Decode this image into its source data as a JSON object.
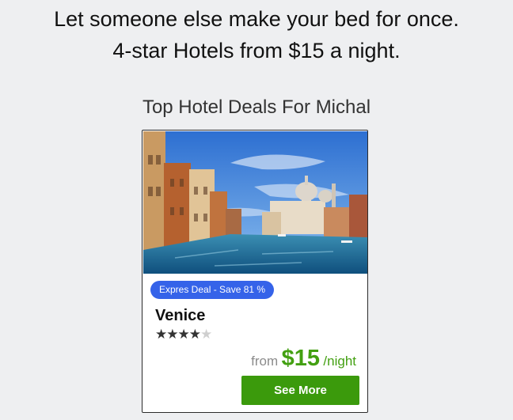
{
  "header": {
    "line1": "Let someone else make your bed for once.",
    "line2": "4-star Hotels from $15 a night."
  },
  "section_title": "Top Hotel Deals For Michal",
  "deal": {
    "badge": "Expres Deal - Save 81 %",
    "city": "Venice",
    "rating": 4,
    "rating_max": 5,
    "price_from": "from",
    "price": "$15",
    "price_unit": "/night",
    "cta": "See More"
  },
  "colors": {
    "background": "#eeeff1",
    "badge": "#3563e9",
    "price": "#43a012",
    "cta": "#3b9a0c"
  }
}
